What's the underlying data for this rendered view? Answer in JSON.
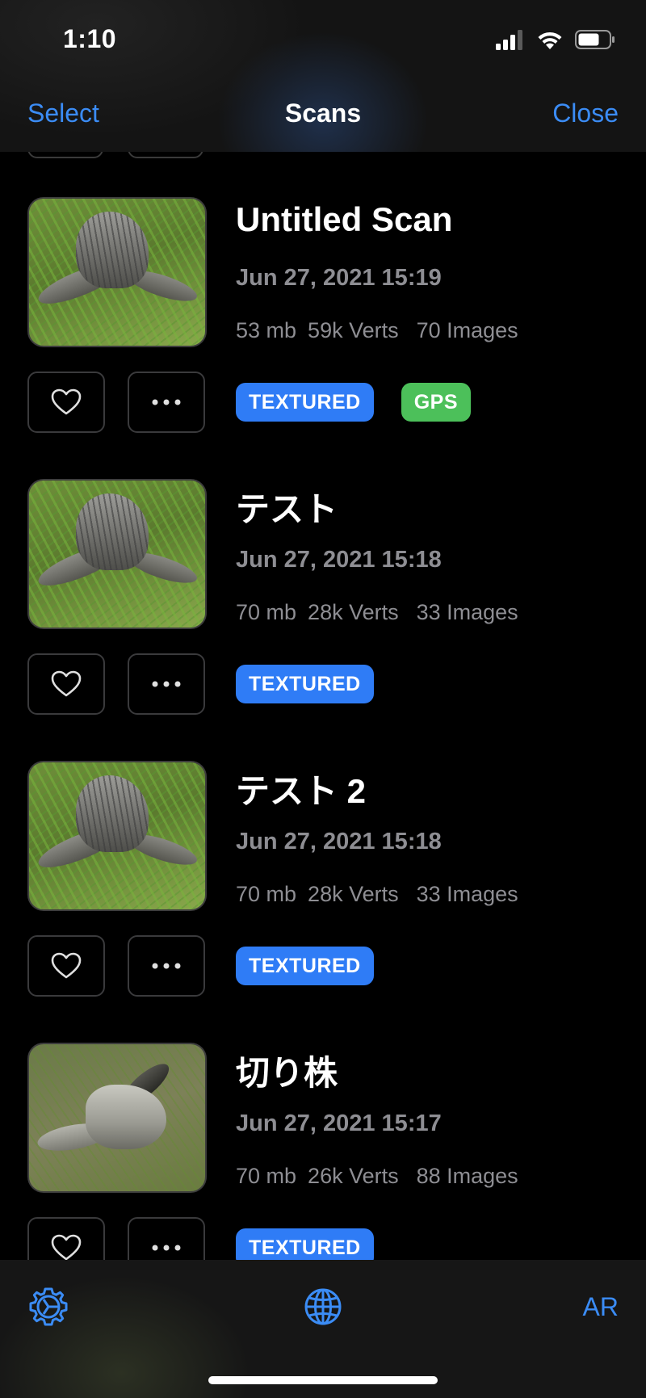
{
  "status_bar": {
    "time": "1:10"
  },
  "nav": {
    "select_label": "Select",
    "title": "Scans",
    "close_label": "Close"
  },
  "colors": {
    "accent": "#3b8cf5",
    "textured_badge": "#2f7cf6",
    "gps_badge": "#4cc05a",
    "secondary_text": "#8e8e93"
  },
  "scans": [
    {
      "title": "Untitled Scan",
      "date": "Jun 27, 2021 15:19",
      "size": "53 mb",
      "verts": "59k Verts",
      "images": "70 Images",
      "badges": [
        "TEXTURED",
        "GPS"
      ],
      "favorite": false
    },
    {
      "title": "テスト",
      "date": "Jun 27, 2021 15:18",
      "size": "70 mb",
      "verts": "28k Verts",
      "images": "33 Images",
      "badges": [
        "TEXTURED"
      ],
      "favorite": false
    },
    {
      "title": "テスト 2",
      "date": "Jun 27, 2021 15:18",
      "size": "70 mb",
      "verts": "28k Verts",
      "images": "33 Images",
      "badges": [
        "TEXTURED"
      ],
      "favorite": false
    },
    {
      "title": "切り株",
      "date": "Jun 27, 2021 15:17",
      "size": "70 mb",
      "verts": "26k Verts",
      "images": "88 Images",
      "badges": [
        "TEXTURED"
      ],
      "favorite": false
    }
  ],
  "tab_bar": {
    "settings_icon": "gear-icon",
    "globe_icon": "globe-icon",
    "ar_label": "AR"
  }
}
